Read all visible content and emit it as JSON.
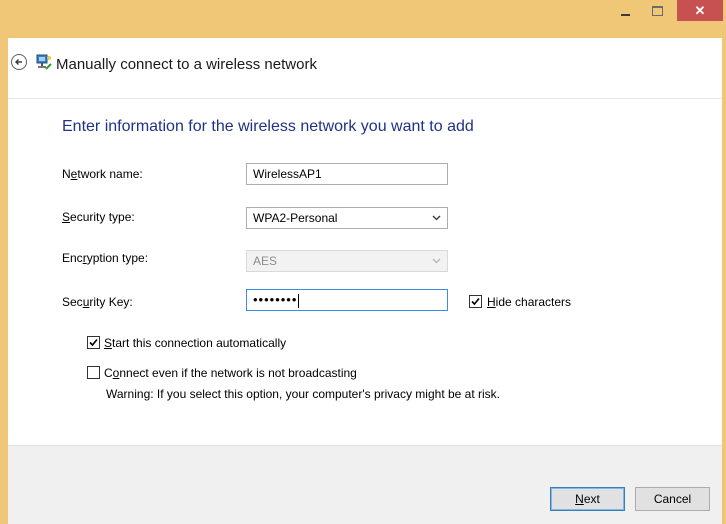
{
  "window": {
    "controls": {
      "minimize_icon": "minimize-icon",
      "maximize_icon": "maximize-icon",
      "close_glyph": "✕"
    },
    "colors": {
      "frame": "#f0c777",
      "close": "#c75050",
      "heading": "#1e3287"
    }
  },
  "header": {
    "title": "Manually connect to a wireless network",
    "back_icon": "back-arrow-icon",
    "network_icon": "network-icon"
  },
  "main": {
    "heading": "Enter information for the wireless network you want to add",
    "fields": {
      "network_name": {
        "label_pre": "N",
        "label_ul": "e",
        "label_post": "twork name:",
        "value": "WirelessAP1"
      },
      "security_type": {
        "label_pre": "",
        "label_ul": "S",
        "label_post": "ecurity type:",
        "value": "WPA2-Personal"
      },
      "encryption_type": {
        "label_pre": "Enc",
        "label_ul": "r",
        "label_post": "yption type:",
        "value": "AES"
      },
      "security_key": {
        "label_pre": "Sec",
        "label_ul": "u",
        "label_post": "rity Key:",
        "value": "••••••••"
      }
    },
    "hide_characters": {
      "label_ul": "H",
      "label_post": "ide characters",
      "checked": true
    },
    "start_auto": {
      "label_ul": "S",
      "label_post": "tart this connection automatically",
      "checked": true
    },
    "connect_even": {
      "label_pre": "C",
      "label_ul": "o",
      "label_post": "nnect even if the network is not broadcasting",
      "checked": false
    },
    "warning": "Warning: If you select this option, your computer's privacy might be at risk."
  },
  "footer": {
    "next": {
      "label_ul": "N",
      "label_post": "ext"
    },
    "cancel": "Cancel"
  }
}
